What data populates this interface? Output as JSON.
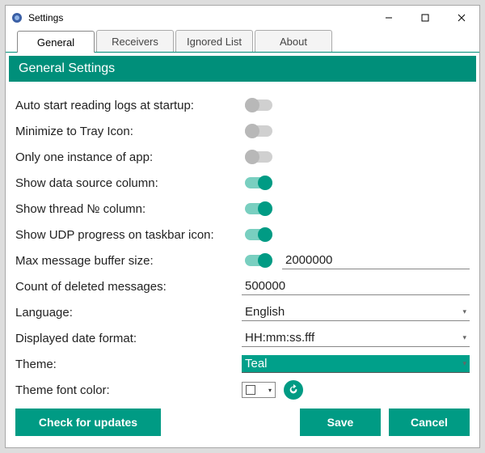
{
  "window": {
    "title": "Settings"
  },
  "tabs": [
    {
      "label": "General",
      "active": true
    },
    {
      "label": "Receivers",
      "active": false
    },
    {
      "label": "Ignored List",
      "active": false
    },
    {
      "label": "About",
      "active": false
    }
  ],
  "section_title": "General Settings",
  "settings": {
    "auto_start": {
      "label": "Auto start reading logs at startup:",
      "on": false
    },
    "minimize_tray": {
      "label": "Minimize to Tray Icon:",
      "on": false
    },
    "single_instance": {
      "label": "Only one instance of app:",
      "on": false
    },
    "show_source": {
      "label": "Show data source column:",
      "on": true
    },
    "show_thread": {
      "label": "Show thread № column:",
      "on": true
    },
    "show_udp": {
      "label": "Show UDP progress on taskbar icon:",
      "on": true
    },
    "max_buffer": {
      "label": "Max message buffer size:",
      "on": true,
      "value": "2000000"
    },
    "deleted_count": {
      "label": "Count of deleted messages:",
      "value": "500000"
    },
    "language": {
      "label": "Language:",
      "value": "English"
    },
    "date_format": {
      "label": "Displayed date format:",
      "value": "HH:mm:ss.fff"
    },
    "theme": {
      "label": "Theme:",
      "value": "Teal"
    },
    "font_color": {
      "label": "Theme font color:",
      "value": "#FFFFFF"
    }
  },
  "footer": {
    "check_updates": "Check for updates",
    "save": "Save",
    "cancel": "Cancel"
  },
  "colors": {
    "accent": "#009b84"
  }
}
